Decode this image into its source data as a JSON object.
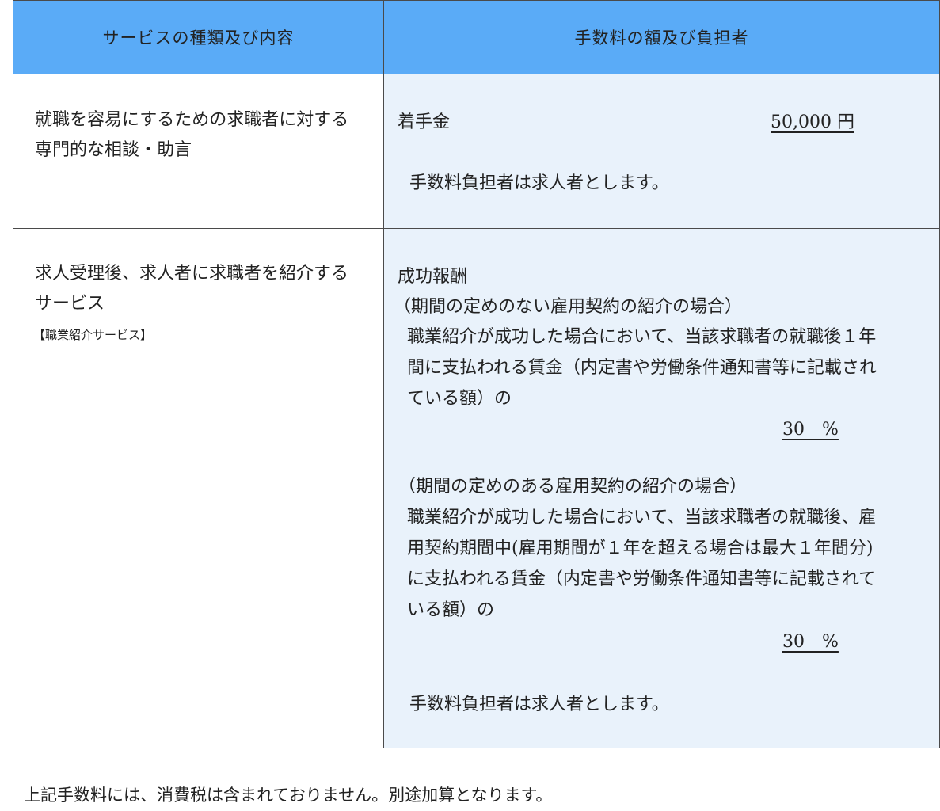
{
  "table": {
    "header": {
      "service_col": "サービスの種類及び内容",
      "fee_col": "手数料の額及び負担者"
    },
    "rows": [
      {
        "service": {
          "line1": "就職を容易にするための求職者に対する",
          "line2": "専門的な相談・助言"
        },
        "fee": {
          "item_label": "着手金",
          "amount": "50,000 円",
          "payer_note": "手数料負担者は求人者とします。"
        }
      },
      {
        "service": {
          "line1": "求人受理後、求人者に求職者を紹介する",
          "line2": "サービス",
          "tag": "【職業紹介サービス】"
        },
        "fee": {
          "item_label": "成功報酬",
          "case1_heading": "（期間の定めのない雇用契約の紹介の場合）",
          "case1_line1": "職業紹介が成功した場合において、当該求職者の就職後１年",
          "case1_line2": "間に支払われる賃金（内定書や労働条件通知書等に記載され",
          "case1_line3": "ている額）の",
          "case1_rate": "30　%",
          "case2_heading": "（期間の定めのある雇用契約の紹介の場合）",
          "case2_line1": "職業紹介が成功した場合において、当該求職者の就職後、雇",
          "case2_line2": "用契約期間中(雇用期間が１年を超える場合は最大１年間分)",
          "case2_line3": "に支払われる賃金（内定書や労働条件通知書等に記載されて",
          "case2_line4": "いる額）の",
          "case2_rate": "30　%",
          "payer_note": "手数料負担者は求人者とします。"
        }
      }
    ]
  },
  "footer_note": "上記手数料には、消費税は含まれておりません。別途加算となります。",
  "colors": {
    "header_bg": "#5aabf7",
    "fee_cell_bg": "#e9f2fb",
    "border": "#4a4a4a"
  }
}
